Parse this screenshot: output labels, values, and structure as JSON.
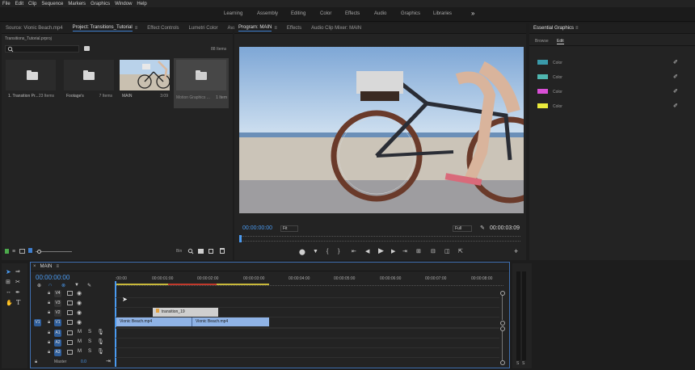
{
  "menu": [
    "File",
    "Edit",
    "Clip",
    "Sequence",
    "Markers",
    "Graphics",
    "Window",
    "Help"
  ],
  "workspaces": [
    "Learning",
    "Assembly",
    "Editing",
    "Color",
    "Effects",
    "Audio",
    "Graphics",
    "Libraries"
  ],
  "workspace_more": "»",
  "project_panel": {
    "tabs": [
      "Source: Vionic Beach.mp4",
      "Project: Transitions_Tutorial",
      "Effect Controls",
      "Lumetri Color",
      "Ava"
    ],
    "menu_icon": "≡",
    "overflow": "»",
    "file_name": "Transitions_Tutorial.prproj",
    "item_count": "88 Items",
    "bins": [
      {
        "name": "1. Transition Pr...",
        "count": "23 Items"
      },
      {
        "name": "Footage's",
        "count": "7 Items"
      },
      {
        "name": "MAIN",
        "count": "3:09"
      },
      {
        "name": "Motion Graphics ...",
        "count": "1 Item"
      }
    ],
    "footer_label": "Bin"
  },
  "program_panel": {
    "tabs": [
      "Program: MAIN",
      "Effects",
      "Audio Clip Mixer: MAIN"
    ],
    "menu_icon": "≡",
    "timecode": "00:00:00:00",
    "fit": "Fit",
    "quality": "Full",
    "duration": "00:00:03:09",
    "add": "+"
  },
  "essential_graphics": {
    "title": "Essential Graphics",
    "menu_icon": "≡",
    "tabs": [
      "Browse",
      "Edit"
    ],
    "swatches": [
      {
        "label": "Color",
        "color": "#3a9aaa"
      },
      {
        "label": "Color",
        "color": "#4fb7b0"
      },
      {
        "label": "Color",
        "color": "#d94fd6"
      },
      {
        "label": "Color",
        "color": "#eaea3c"
      }
    ]
  },
  "timeline": {
    "close": "×",
    "name": "MAIN",
    "menu_icon": "≡",
    "timecode": "00:00:00:00",
    "ruler": [
      ":00:00",
      "00:00:01:00",
      "00:00:02:00",
      "00:00:03:00",
      "00:00:04:00",
      "00:00:05:00",
      "00:00:06:00",
      "00:00:07:00",
      "00:00:08:00"
    ],
    "video_tracks": [
      "V4",
      "V3",
      "V2",
      "V1"
    ],
    "audio_tracks": [
      "A1",
      "A2",
      "A3"
    ],
    "master": "Master",
    "master_value": "0.0",
    "clips": {
      "transition": "transition_19",
      "v1a": "Vionic Beach.mp4",
      "v1b": "Vionic Beach.mp4"
    },
    "meter_labels": [
      "S",
      "S"
    ]
  },
  "colors": {
    "accent": "#4a9af0",
    "clip_video": "#8fb3e6",
    "clip_graphic": "#cfcfcf",
    "target_blue": "#2e5d9a"
  }
}
